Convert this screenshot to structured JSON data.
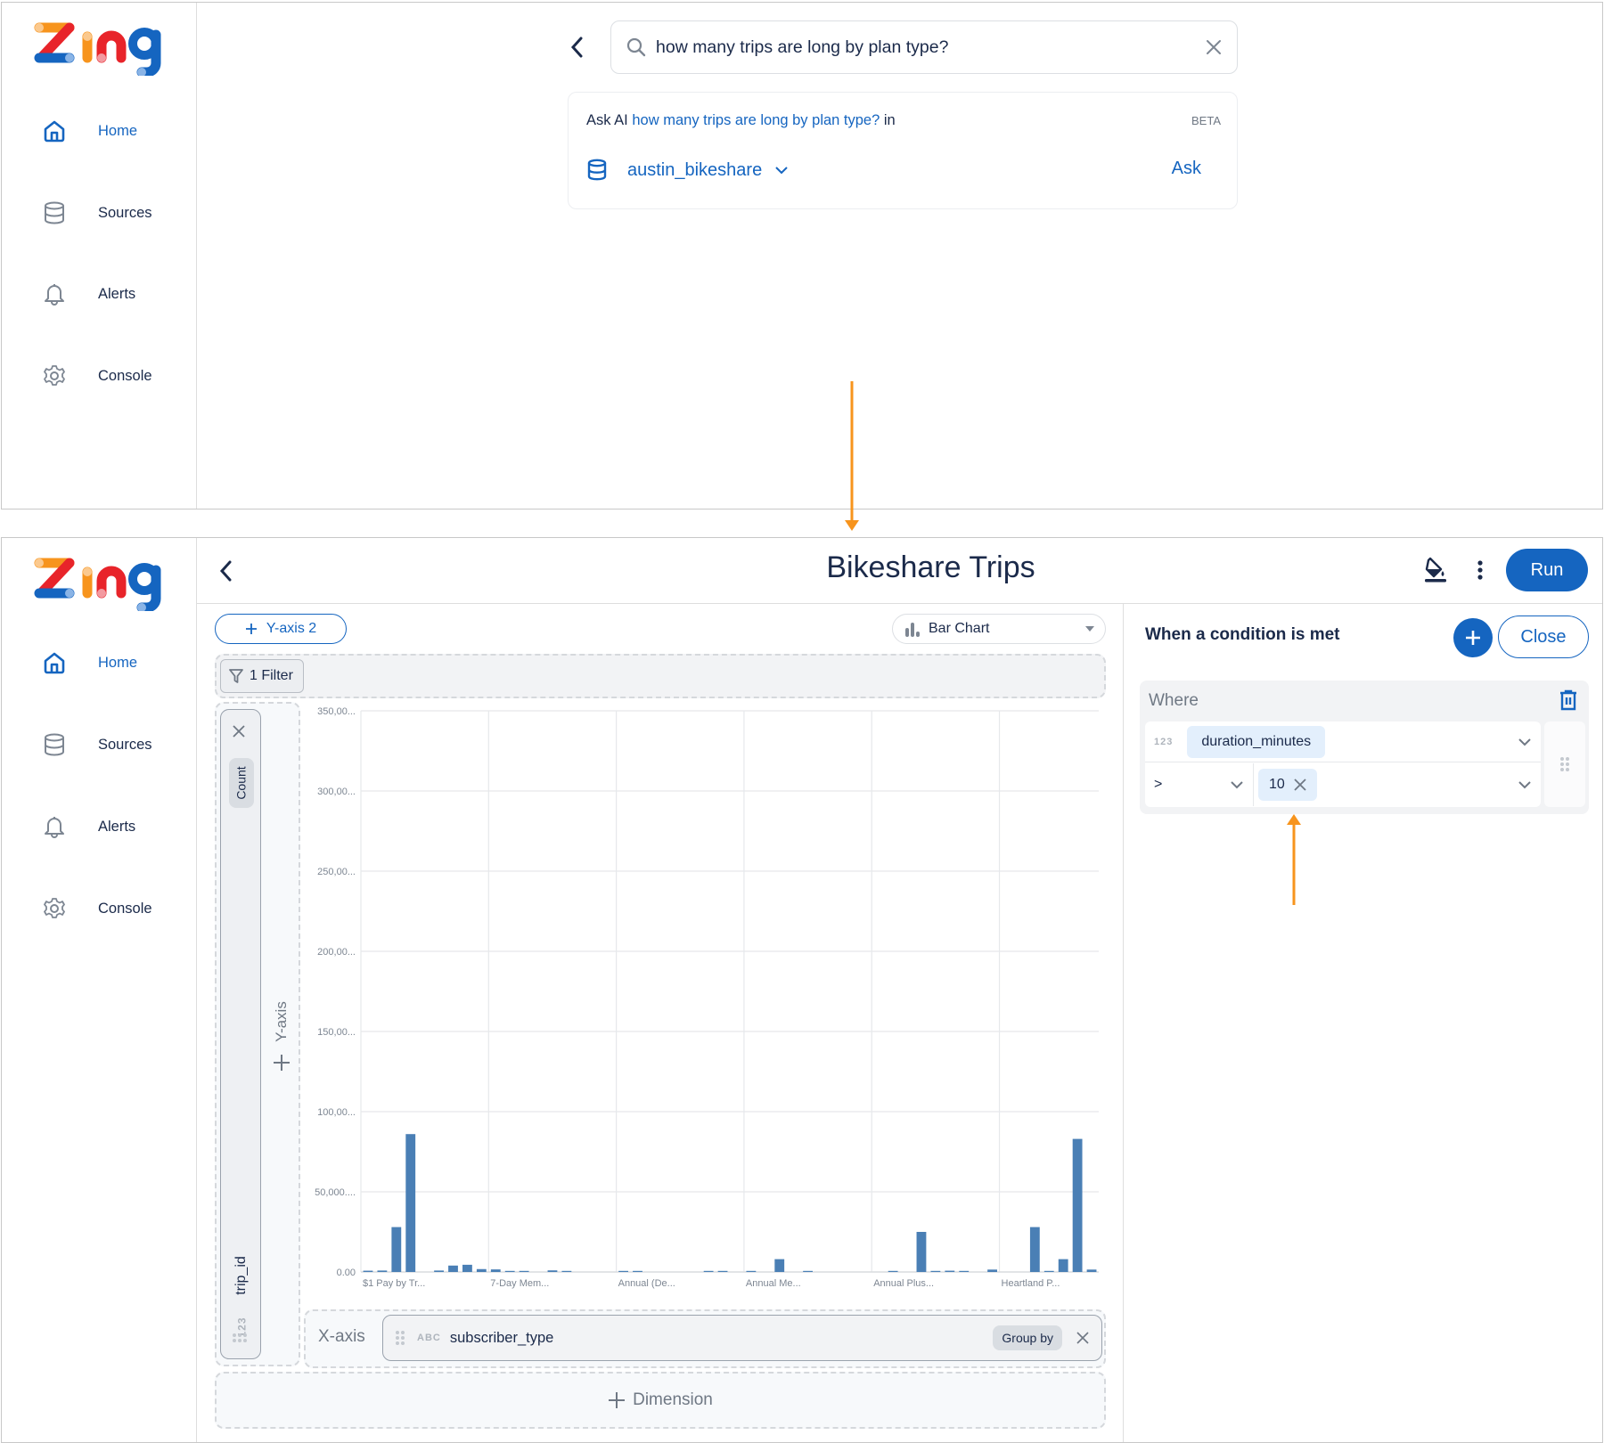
{
  "brand": {
    "name": "Zing",
    "logo_colors": [
      "#f7941d",
      "#e8242a",
      "#1565c0"
    ],
    "accent": "#1565c0",
    "annotation_color": "#f7941d"
  },
  "sidebar": {
    "items": [
      {
        "label": "Home",
        "icon": "home-icon",
        "active": true
      },
      {
        "label": "Sources",
        "icon": "database-icon",
        "active": false
      },
      {
        "label": "Alerts",
        "icon": "bell-icon",
        "active": false
      },
      {
        "label": "Console",
        "icon": "gear-icon",
        "active": false
      }
    ]
  },
  "search_screen": {
    "query": "how many trips are long by plan type?",
    "ask_ai": {
      "prefix": "Ask AI",
      "question": "how many trips are long by plan type?",
      "suffix": "in",
      "beta_label": "BETA",
      "source": "austin_bikeshare",
      "ask_label": "Ask"
    }
  },
  "query_screen": {
    "title": "Bikeshare Trips",
    "run_label": "Run",
    "toolbar_icons": [
      "paint-bucket-icon",
      "more-vertical-icon"
    ],
    "yaxis2_label": "Y-axis 2",
    "chart_type": "Bar Chart",
    "filter_label": "1 Filter",
    "measure": {
      "aggregate": "Count",
      "field": "trip_id",
      "type": "123"
    },
    "add_yaxis_label": "Y-axis",
    "xaxis_label": "X-axis",
    "dimension": {
      "field": "subscriber_type",
      "type": "ABC",
      "mode": "Group by"
    },
    "add_dimension_label": "Dimension"
  },
  "condition_panel": {
    "title": "When a condition is met",
    "close_label": "Close",
    "where_label": "Where",
    "field_type": "123",
    "field": "duration_minutes",
    "operator": ">",
    "value": "10"
  },
  "chart_data": {
    "type": "bar",
    "title": "",
    "xlabel": "subscriber_type",
    "ylabel": "Count of trip_id",
    "ylim": [
      0,
      350000
    ],
    "yticks": [
      "0.00",
      "50,000....",
      "100,00...",
      "150,00...",
      "200,00...",
      "250,00...",
      "300,00...",
      "350,00..."
    ],
    "xtick_labels": [
      "$1 Pay by Tr...",
      "7-Day Mem...",
      "Annual (De...",
      "Annual Me...",
      "Annual Plus...",
      "Heartland P..."
    ],
    "xtick_every": 9,
    "grid": true,
    "color": "#4a7fb5",
    "values": [
      800,
      900,
      28000,
      86000,
      0,
      900,
      4000,
      4500,
      1800,
      1600,
      400,
      400,
      0,
      1000,
      300,
      0,
      0,
      0,
      200,
      200,
      0,
      0,
      0,
      0,
      200,
      300,
      0,
      300,
      0,
      8000,
      0,
      200,
      0,
      0,
      0,
      0,
      0,
      200,
      0,
      25000,
      300,
      800,
      600,
      0,
      1500,
      0,
      0,
      28000,
      400,
      8000,
      83000,
      1500
    ]
  }
}
